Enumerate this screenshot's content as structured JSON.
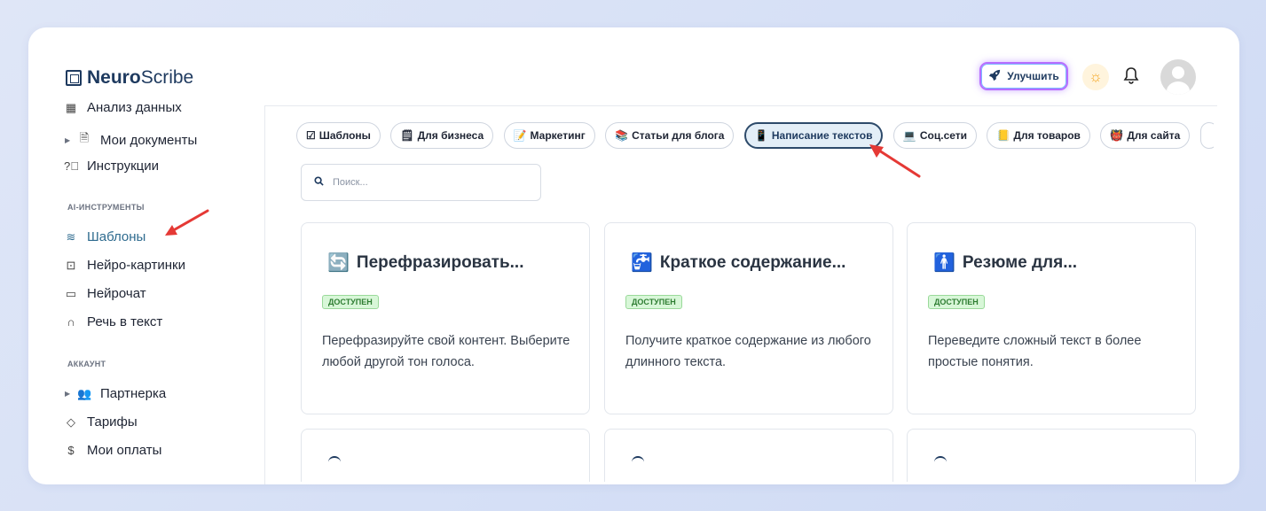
{
  "app": {
    "logo_bold": "Neuro",
    "logo_rest": "Scribe"
  },
  "header": {
    "upgrade_label": "Улучшить"
  },
  "sidebar": {
    "items_top": [
      {
        "label": "Анализ данных",
        "icon": "grid-icon"
      },
      {
        "label": "Мои документы",
        "icon": "document-icon",
        "expandable": true
      },
      {
        "label": "Инструкции",
        "icon": "help-circle-icon"
      }
    ],
    "section_ai": "AI-ИНСТРУМЕНТЫ",
    "items_ai": [
      {
        "label": "Шаблоны",
        "icon": "layers-icon",
        "active": true
      },
      {
        "label": "Нейро-картинки",
        "icon": "image-icon"
      },
      {
        "label": "Нейрочат",
        "icon": "chat-icon"
      },
      {
        "label": "Речь в текст",
        "icon": "headphones-icon"
      }
    ],
    "section_account": "АККАУНТ",
    "items_account": [
      {
        "label": "Партнерка",
        "icon": "users-icon",
        "expandable": true
      },
      {
        "label": "Тарифы",
        "icon": "tag-icon"
      },
      {
        "label": "Мои оплаты",
        "icon": "dollar-icon"
      }
    ]
  },
  "chips": [
    {
      "emoji": "☑",
      "label": "Шаблоны"
    },
    {
      "emoji": "🗒",
      "label": "Для бизнеса"
    },
    {
      "emoji": "📝",
      "label": "Маркетинг"
    },
    {
      "emoji": "📚",
      "label": "Статьи для блога"
    },
    {
      "emoji": "📱",
      "label": "Написание текстов",
      "active": true
    },
    {
      "emoji": "💻",
      "label": "Соц.сети"
    },
    {
      "emoji": "📒",
      "label": "Для товаров"
    },
    {
      "emoji": "👹",
      "label": "Для сайта"
    }
  ],
  "search": {
    "placeholder": "Поиск..."
  },
  "cards": [
    {
      "icon": "🔄",
      "title": "Перефразировать...",
      "badge": "ДОСТУПЕН",
      "desc": "Перефразируйте свой контент. Выберите любой другой тон голоса."
    },
    {
      "icon": "🚰",
      "title": "Краткое содержание...",
      "badge": "ДОСТУПЕН",
      "desc": "Получите краткое содержание из любого длинного текста."
    },
    {
      "icon": "🚹",
      "title": "Резюме для...",
      "badge": "ДОСТУПЕН",
      "desc": "Переведите сложный текст в более простые понятия."
    }
  ],
  "colors": {
    "accent": "#2d6a8e",
    "arrow": "#e53935",
    "badge_bg": "#d8f7d8",
    "badge_text": "#2e7d32"
  }
}
